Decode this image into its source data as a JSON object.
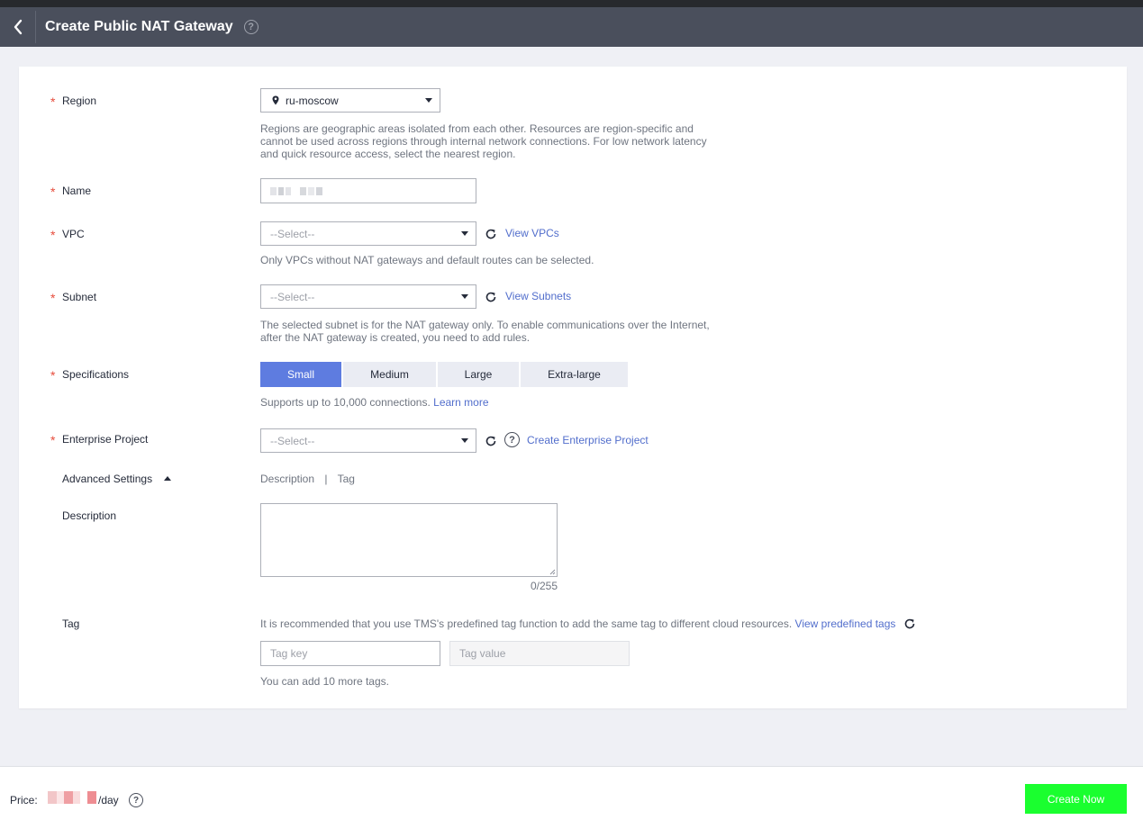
{
  "header": {
    "title": "Create Public NAT Gateway",
    "help_icon": "?"
  },
  "form": {
    "region": {
      "label": "Region",
      "value": "ru-moscow",
      "hint": "Regions are geographic areas isolated from each other. Resources are region-specific and cannot be used across regions through internal network connections. For low network latency and quick resource access, select the nearest region."
    },
    "name": {
      "label": "Name",
      "value": ""
    },
    "vpc": {
      "label": "VPC",
      "placeholder": "--Select--",
      "link": "View VPCs",
      "hint": "Only VPCs without NAT gateways and default routes can be selected."
    },
    "subnet": {
      "label": "Subnet",
      "placeholder": "--Select--",
      "link": "View Subnets",
      "hint": "The selected subnet is for the NAT gateway only. To enable communications over the Internet, after the NAT gateway is created, you need to add rules."
    },
    "specifications": {
      "label": "Specifications",
      "options": [
        "Small",
        "Medium",
        "Large",
        "Extra-large"
      ],
      "selected": "Small",
      "hint": "Supports up to 10,000 connections.",
      "hint_link": "Learn more"
    },
    "enterprise_project": {
      "label": "Enterprise Project",
      "placeholder": "--Select--",
      "link": "Create Enterprise Project"
    },
    "advanced": {
      "label": "Advanced Settings",
      "tab_description": "Description",
      "separator": "|",
      "tab_tag": "Tag"
    },
    "description": {
      "label": "Description",
      "counter": "0/255"
    },
    "tag": {
      "label": "Tag",
      "hint": "It is recommended that you use TMS's predefined tag function to add the same tag to different cloud resources.",
      "hint_link": "View predefined tags",
      "key_placeholder": "Tag key",
      "value_placeholder": "Tag value",
      "more_text": "You can add 10 more tags."
    }
  },
  "footer": {
    "price_label": "Price:",
    "price_unit": "/day",
    "create_button": "Create Now"
  },
  "colors": {
    "header_bg": "#4a4f5c",
    "primary": "#5e7ce0",
    "link": "#526ecc",
    "required": "#e74c3c",
    "create_button": "#1aff2f"
  }
}
